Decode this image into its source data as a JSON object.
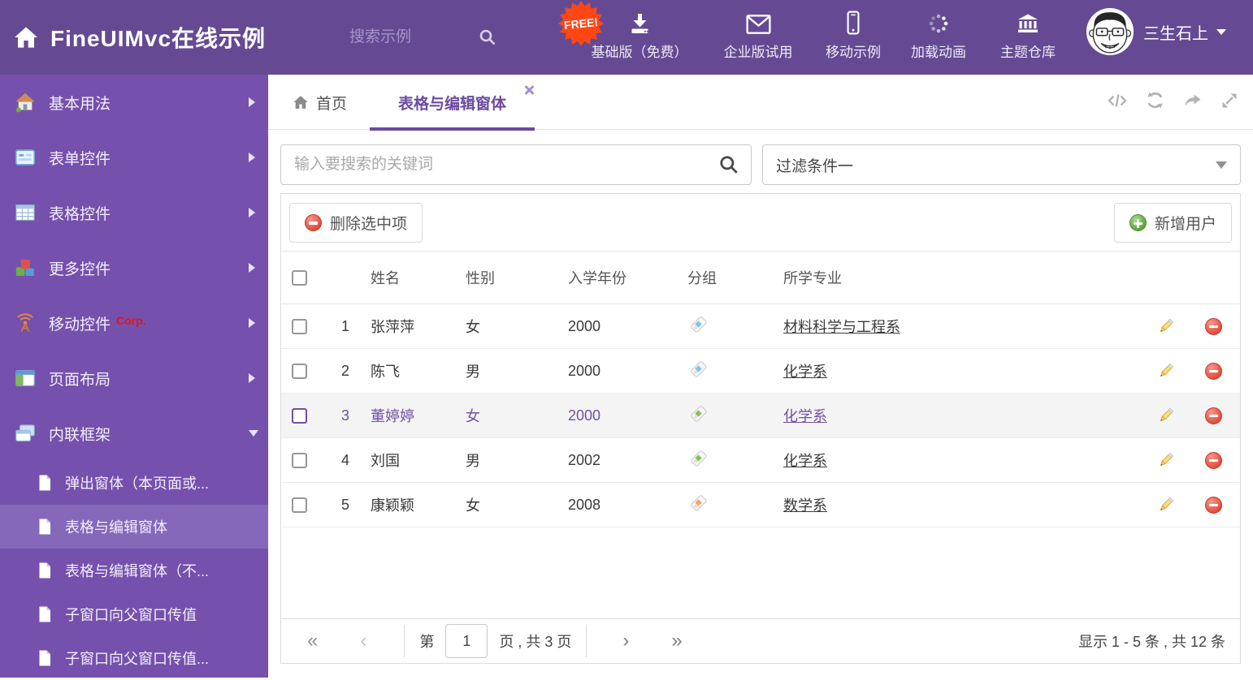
{
  "header": {
    "title": "FineUIMvc在线示例",
    "search_placeholder": "搜索示例",
    "free_badge": "FREE!",
    "nav": [
      {
        "label": "基础版（免费）",
        "icon": "download-icon"
      },
      {
        "label": "企业版试用",
        "icon": "envelope-icon"
      },
      {
        "label": "移动示例",
        "icon": "mobile-icon"
      },
      {
        "label": "加载动画",
        "icon": "spinner-icon"
      },
      {
        "label": "主题仓库",
        "icon": "bank-icon"
      }
    ],
    "user": {
      "name": "三生石上",
      "avatar": "cartoon-face-avatar"
    }
  },
  "sidebar": {
    "items": [
      {
        "label": "基本用法",
        "icon": "house-icon"
      },
      {
        "label": "表单控件",
        "icon": "form-icon"
      },
      {
        "label": "表格控件",
        "icon": "grid-table-icon"
      },
      {
        "label": "更多控件",
        "icon": "cubes-icon"
      },
      {
        "label": "移动控件",
        "badge": "Corp.",
        "icon": "antenna-icon"
      },
      {
        "label": "页面布局",
        "icon": "layout-icon"
      },
      {
        "label": "内联框架",
        "icon": "frames-icon",
        "expanded": true
      }
    ],
    "subitems": [
      {
        "label": "弹出窗体（本页面或...",
        "active": false
      },
      {
        "label": "表格与编辑窗体",
        "active": true
      },
      {
        "label": "表格与编辑窗体（不...",
        "active": false
      },
      {
        "label": "子窗口向父窗口传值",
        "active": false
      },
      {
        "label": "子窗口向父窗口传值...",
        "active": false
      }
    ]
  },
  "tabs": {
    "home": "首页",
    "active": "表格与编辑窗体"
  },
  "tab_actions": [
    {
      "icon": "code-icon"
    },
    {
      "icon": "refresh-icon"
    },
    {
      "icon": "share-icon"
    },
    {
      "icon": "fullscreen-icon"
    }
  ],
  "filters": {
    "search_placeholder": "输入要搜索的关键词",
    "filter_value": "过滤条件一"
  },
  "toolbar": {
    "delete_label": "删除选中项",
    "add_label": "新增用户"
  },
  "table": {
    "columns": [
      "姓名",
      "性别",
      "入学年份",
      "分组",
      "所学专业"
    ],
    "rows": [
      {
        "index": "1",
        "name": "张萍萍",
        "gender": "女",
        "year": "2000",
        "tag_color": "#7cc4ef",
        "major": "材料科学与工程系",
        "selected": false
      },
      {
        "index": "2",
        "name": "陈飞",
        "gender": "男",
        "year": "2000",
        "tag_color": "#7cc4ef",
        "major": "化学系",
        "selected": false
      },
      {
        "index": "3",
        "name": "董婷婷",
        "gender": "女",
        "year": "2000",
        "tag_color": "#8fbf4d",
        "major": "化学系",
        "selected": true
      },
      {
        "index": "4",
        "name": "刘国",
        "gender": "男",
        "year": "2002",
        "tag_color": "#8fbf4d",
        "major": "化学系",
        "selected": false
      },
      {
        "index": "5",
        "name": "康颖颖",
        "gender": "女",
        "year": "2008",
        "tag_color": "#f5a95b",
        "major": "数学系",
        "selected": false
      }
    ]
  },
  "pagination": {
    "first_glyph": "«",
    "prev_glyph": "‹",
    "next_glyph": "›",
    "last_glyph": "»",
    "prefix": "第",
    "page": "1",
    "suffix": "页 , 共 3 页",
    "summary": "显示 1 - 5 条 , 共 12 条"
  },
  "colors": {
    "header_bg": "#654a93",
    "sidebar_bg": "#7551ad",
    "sidebar_active_bg": "#8668bb",
    "accent": "#6b4aa1",
    "free_badge": "#ff4716",
    "delete_red": "#e04a3a",
    "add_green": "#58a436",
    "tag_blue": "#7cc4ef",
    "tag_green": "#8fbf4d",
    "tag_orange": "#f5a95b"
  }
}
